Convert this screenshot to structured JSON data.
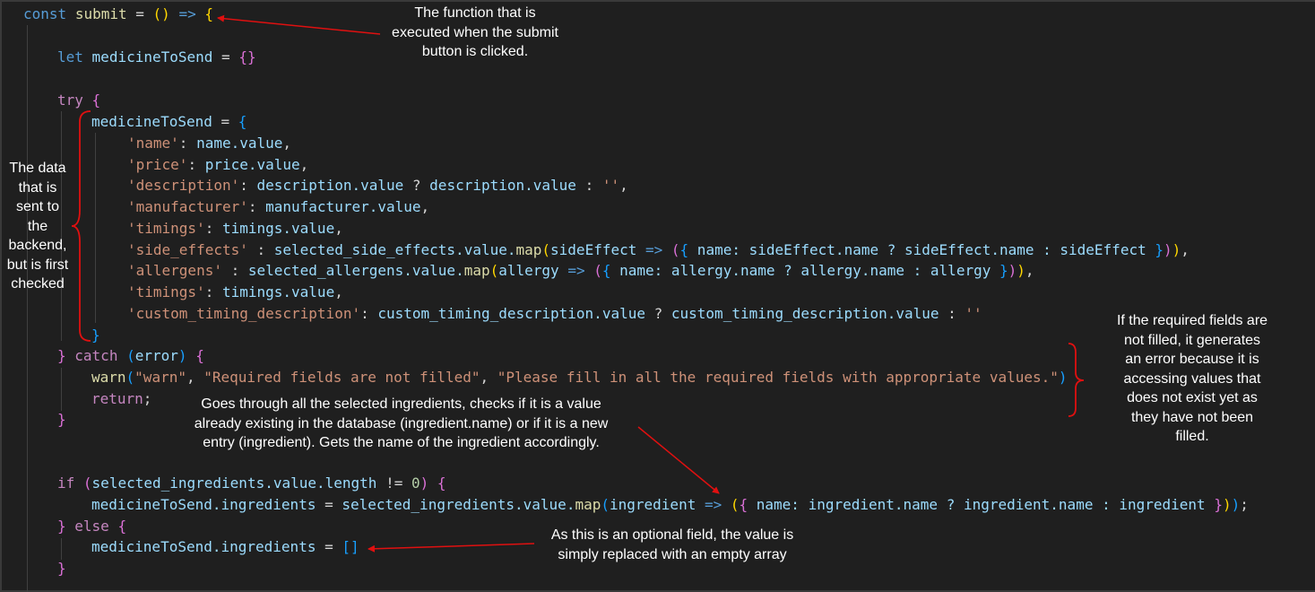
{
  "code": {
    "line1": [
      "const",
      "submit",
      "=",
      "()",
      "=>",
      "{"
    ],
    "line2": [
      "let",
      "medicineToSend",
      "=",
      "{}"
    ],
    "line3": [
      "try",
      "{"
    ],
    "line4": [
      "medicineToSend",
      "=",
      "{"
    ],
    "line5": [
      "'name'",
      ": ",
      "name.value",
      ","
    ],
    "line6": [
      "'price'",
      ": ",
      "price.value",
      ","
    ],
    "line7": [
      "'description'",
      ": ",
      "description.value",
      " ? ",
      "description.value",
      " : ",
      "''",
      ","
    ],
    "line8": [
      "'manufacturer'",
      ": ",
      "manufacturer.value",
      ","
    ],
    "line9": [
      "'timings'",
      ": ",
      "timings.value",
      ","
    ],
    "line10": [
      "'side_effects'",
      " : ",
      "selected_side_effects.value.",
      "map",
      "(",
      "sideEffect",
      " => ",
      "(",
      "{",
      " name: sideEffect.name ? sideEffect.name : sideEffect ",
      "}",
      ")",
      ")",
      ","
    ],
    "line11": [
      "'allergens'",
      " : ",
      "selected_allergens.value.",
      "map",
      "(",
      "allergy",
      " => ",
      "(",
      "{",
      " name: allergy.name ? allergy.name : allergy ",
      "}",
      ")",
      ")",
      ","
    ],
    "line12": [
      "'timings'",
      ": ",
      "timings.value",
      ","
    ],
    "line13": [
      "'custom_timing_description'",
      ": ",
      "custom_timing_description.value",
      " ? ",
      "custom_timing_description.value",
      " : ",
      "''"
    ],
    "line14": [
      "}"
    ],
    "line15": [
      "}",
      "catch",
      "(",
      "error",
      ")",
      "{"
    ],
    "line16": [
      "warn",
      "(",
      "\"warn\"",
      ", ",
      "\"Required fields are not filled\"",
      ", ",
      "\"Please fill in all the required fields with appropriate values.\"",
      ")"
    ],
    "line17": [
      "return",
      ";"
    ],
    "line18": [
      "}"
    ],
    "line19": [
      "if",
      "(",
      "selected_ingredients.value.length",
      " != ",
      "0",
      ")",
      "{"
    ],
    "line20": [
      "medicineToSend.ingredients",
      " = ",
      "selected_ingredients.value.",
      "map",
      "(",
      "ingredient",
      " => ",
      "(",
      "{",
      " name: ingredient.name ? ingredient.name : ingredient ",
      "}",
      ")",
      ")",
      ";"
    ],
    "line21": [
      "}",
      "else",
      "{"
    ],
    "line22": [
      "medicineToSend.ingredients",
      " = ",
      "[]"
    ],
    "line23": [
      "}"
    ]
  },
  "annotations": {
    "submit_note": [
      "The function that is",
      "executed when the submit",
      "button is clicked."
    ],
    "data_note": [
      "The data",
      "that is",
      "sent to",
      "the",
      "backend,",
      "but is first",
      "checked"
    ],
    "required_note": [
      "If the required fields are",
      "not filled, it generates",
      "an error because it is",
      "accessing values that",
      "does not exist yet as",
      "they have not been",
      "filled."
    ],
    "ingredients_note": [
      "Goes through all the selected ingredients, checks if it is a value",
      "already existing in the database (ingredient.name) or if it is a new",
      "entry (ingredient). Gets the name of the ingredient accordingly."
    ],
    "optional_note": [
      "As this is an optional field, the value is",
      "simply replaced with an empty array"
    ]
  },
  "colors": {
    "background": "#1f1f1f",
    "keyword": "#569cd6",
    "control": "#c586c0",
    "variable": "#9cdcfe",
    "function": "#dcdcaa",
    "string": "#ce9178",
    "number": "#b5cea8",
    "annotation_arrow": "#e01010"
  }
}
